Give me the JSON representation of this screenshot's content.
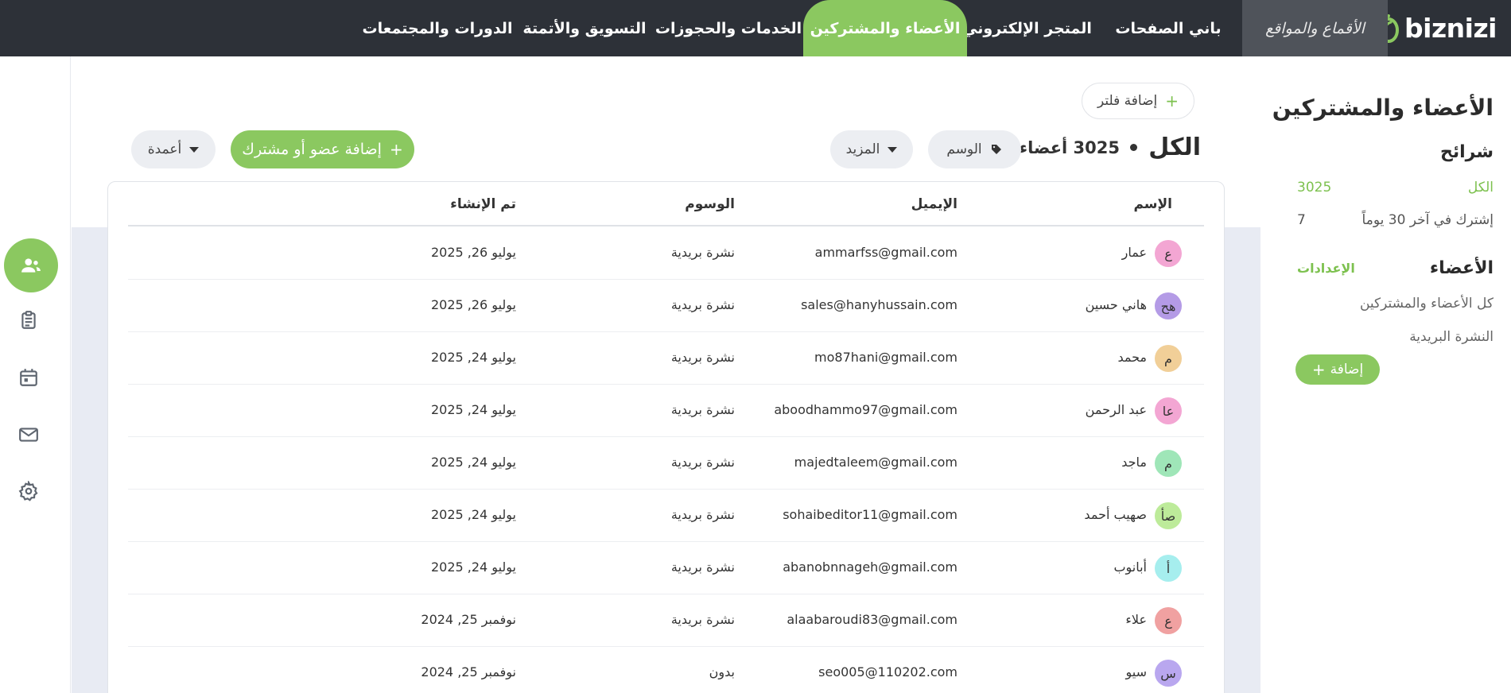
{
  "brand": {
    "logo_text": "biznizi"
  },
  "nav": {
    "items": [
      {
        "label": "الأقماع والمواقع"
      },
      {
        "label": "باني الصفحات"
      },
      {
        "label": "المتجر الإلكتروني"
      },
      {
        "label": "الأعضاء والمشتركين"
      },
      {
        "label": "الخدمات والحجوزات"
      },
      {
        "label": "التسويق والأتمتة"
      },
      {
        "label": "الدورات والمجتمعات"
      }
    ],
    "active_index": 3
  },
  "rail": {
    "icons": [
      "members-icon",
      "clipboard-icon",
      "calendar-icon",
      "mail-icon",
      "gear-icon"
    ]
  },
  "sidebar": {
    "title": "الأعضاء والمشتركين",
    "segments_title": "شرائح",
    "segments": [
      {
        "label": "الكل",
        "count": "3025"
      },
      {
        "label": "إشترك في آخر 30 يوماً",
        "count": "7"
      }
    ],
    "members_title": "الأعضاء",
    "settings_label": "الإعدادات",
    "links": [
      "كل الأعضاء والمشتركين",
      "النشرة البريدية"
    ],
    "add_label": "إضافة"
  },
  "toolbar": {
    "add_filter": "إضافة فلتر",
    "title": "الكل",
    "count": "3025 أعضاء",
    "tag_filter": "الوسم",
    "more": "المزيد",
    "add_member": "إضافة عضو أو مشترك",
    "columns": "أعمدة"
  },
  "table": {
    "headers": {
      "name": "الإسم",
      "email": "الإيميل",
      "tags": "الوسوم",
      "created": "تم الإنشاء"
    },
    "rows": [
      {
        "initials": "ع",
        "avatar_color": "#f3a6d3",
        "name": "عمار",
        "email": "ammarfss@gmail.com",
        "tag": "نشرة بريدية",
        "created": "يوليو 26, 2025"
      },
      {
        "initials": "هح",
        "avatar_color": "#b49be6",
        "name": "هاني حسين",
        "email": "sales@hanyhussain.com",
        "tag": "نشرة بريدية",
        "created": "يوليو 26, 2025"
      },
      {
        "initials": "م",
        "avatar_color": "#f1cf98",
        "name": "محمد",
        "email": "mo87hani@gmail.com",
        "tag": "نشرة بريدية",
        "created": "يوليو 24, 2025"
      },
      {
        "initials": "عا",
        "avatar_color": "#f3a6d3",
        "name": "عبد الرحمن",
        "email": "aboodhammo97@gmail.com",
        "tag": "نشرة بريدية",
        "created": "يوليو 24, 2025"
      },
      {
        "initials": "م",
        "avatar_color": "#9fe6b8",
        "name": "ماجد",
        "email": "majedtaleem@gmail.com",
        "tag": "نشرة بريدية",
        "created": "يوليو 24, 2025"
      },
      {
        "initials": "صأ",
        "avatar_color": "#bdeb9a",
        "name": "صهيب أحمد",
        "email": "sohaibeditor11@gmail.com",
        "tag": "نشرة بريدية",
        "created": "يوليو 24, 2025"
      },
      {
        "initials": "أ",
        "avatar_color": "#a6eeee",
        "name": "أبانوب",
        "email": "abanobnnageh@gmail.com",
        "tag": "نشرة بريدية",
        "created": "يوليو 24, 2025"
      },
      {
        "initials": "ع",
        "avatar_color": "#f0a1a1",
        "name": "علاء",
        "email": "alaabaroudi83@gmail.com",
        "tag": "نشرة بريدية",
        "created": "نوفمبر 25, 2024"
      },
      {
        "initials": "س",
        "avatar_color": "#b9a7ef",
        "name": "سيو",
        "email": "seo005@110202.com",
        "tag": "بدون",
        "created": "نوفمبر 25, 2024"
      }
    ]
  },
  "colors": {
    "accent": "#8bc860",
    "topbar": "#2d3138",
    "canvas": "#e8ebf3"
  }
}
